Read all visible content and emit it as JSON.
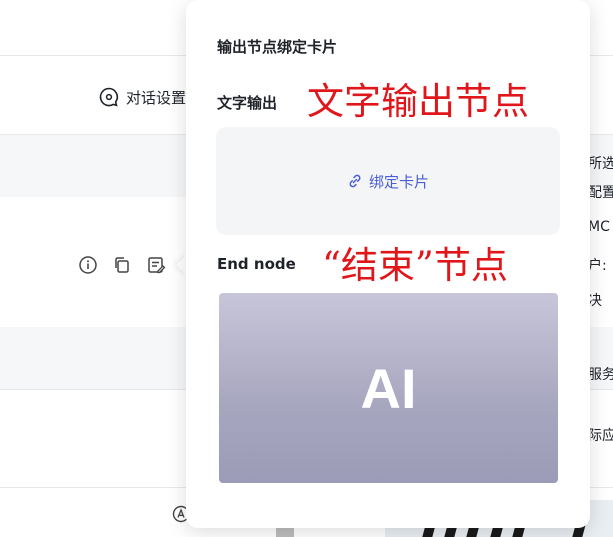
{
  "toolbar": {
    "dialog_settings_label": "对话设置"
  },
  "popup": {
    "title": "输出节点绑定卡片",
    "text_output_label": "文字输出",
    "text_output_annotation": "文字输出节点",
    "bind_card_label": "绑定卡片",
    "end_node_label": "End node",
    "end_node_annotation": "“结束”节点",
    "image_card_text": "AI"
  },
  "right_panel_fragments": [
    "所选",
    "配置",
    "MC",
    "户:",
    "决",
    "服务",
    "际应"
  ],
  "colors": {
    "accent_link": "#4a5fd6",
    "annotation_red": "#e0161b"
  }
}
